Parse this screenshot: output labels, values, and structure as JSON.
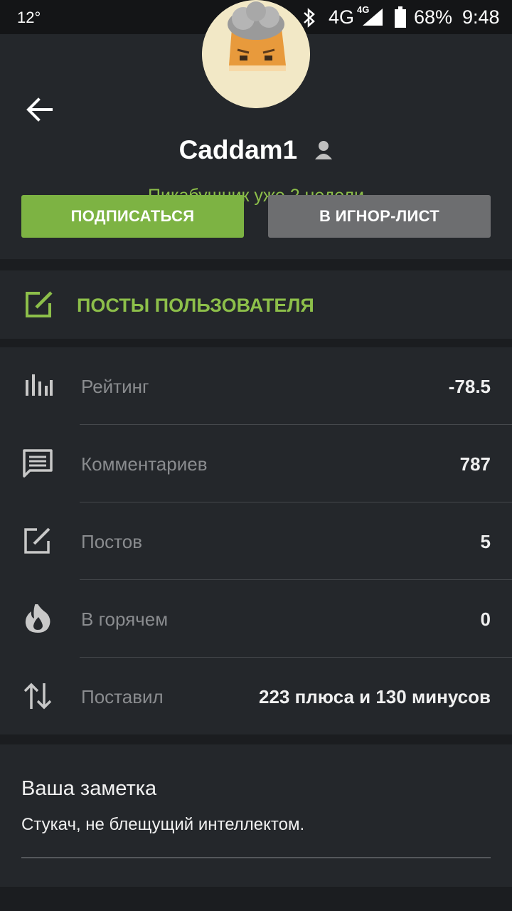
{
  "status_bar": {
    "temperature": "12°",
    "network": "4G",
    "network_small": "4G",
    "battery": "68%",
    "time": "9:48"
  },
  "profile": {
    "username": "Caddam1",
    "tenure": "Пикабушник уже 2 недели",
    "subscribe_label": "ПОДПИСАТЬСЯ",
    "ignore_label": "В ИГНОР-ЛИСТ"
  },
  "posts_link": {
    "label": "ПОСТЫ ПОЛЬЗОВАТЕЛЯ",
    "icon": "edit-icon"
  },
  "stats": [
    {
      "icon": "rating-bars-icon",
      "label": "Рейтинг",
      "value": "-78.5"
    },
    {
      "icon": "comment-icon",
      "label": "Комментариев",
      "value": "787"
    },
    {
      "icon": "edit-icon",
      "label": "Постов",
      "value": "5"
    },
    {
      "icon": "flame-icon",
      "label": "В горячем",
      "value": "0"
    },
    {
      "icon": "up-down-arrows-icon",
      "label": "Поставил",
      "value": "223 плюса и 130 минусов"
    }
  ],
  "note": {
    "title": "Ваша заметка",
    "text": "Стукач,  не блещущий интеллектом."
  },
  "colors": {
    "accent_green": "#7db343",
    "green_text": "#8dbf4a",
    "panel": "#24272b",
    "background": "#1b1d20"
  }
}
